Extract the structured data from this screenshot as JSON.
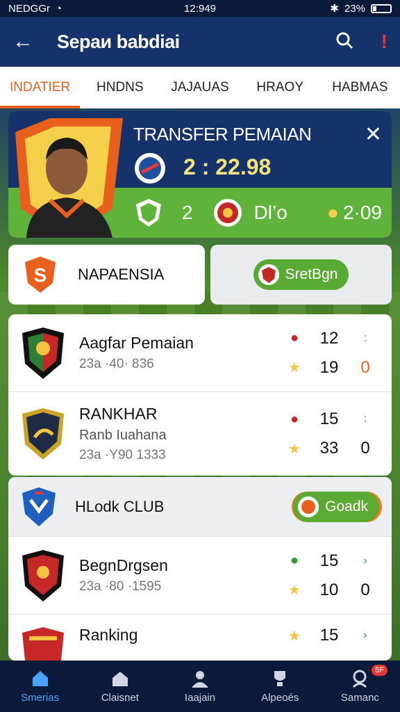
{
  "status": {
    "left_text": "NEDGGr",
    "time": "12:949",
    "battery": "23%"
  },
  "appbar": {
    "title": "Sepaи babdiai"
  },
  "tabs": [
    {
      "label": "INDATIER",
      "active": true
    },
    {
      "label": "HNDNS"
    },
    {
      "label": "JAJAUAS"
    },
    {
      "label": "HRAOY"
    },
    {
      "label": "HABMAS"
    }
  ],
  "transfer": {
    "title": "TRANSFER PEMAIAN",
    "score": "2 : 22.98",
    "left_num": "2",
    "mid_text": "Dl’o",
    "right_val": "2·09"
  },
  "sections": {
    "nap": {
      "label": "NAPAENSIA",
      "pill": "SretBgn"
    },
    "club": {
      "label": "HLodk CLUB",
      "pill": "Goadk"
    }
  },
  "rows": [
    {
      "name": "Aagfar Pemaian",
      "sub": "23a ·40· 836",
      "top_num": "12",
      "bottom_num": "19",
      "bottom_side": "0",
      "top_side": ":"
    },
    {
      "name": "RANKHAR",
      "name2": "Ranb Iuahana",
      "sub": "23a ·Y90 1333",
      "top_num": "15",
      "bottom_num": "33",
      "bottom_side": "0",
      "top_side": ":"
    },
    {
      "name": "BegnDrgsen",
      "sub": "23a ·80 ·1595",
      "top_num": "15",
      "bottom_num": "10",
      "bottom_side": "0",
      "top_side": "›"
    },
    {
      "name": "Ranking",
      "sub": "",
      "top_num": "15",
      "bottom_num": "",
      "bottom_side": "",
      "top_side": "›"
    }
  ],
  "nav": [
    {
      "label": "Smerias",
      "icon": "home-icon",
      "active": true
    },
    {
      "label": "Claisnet",
      "icon": "stadium-icon"
    },
    {
      "label": "Iaajain",
      "icon": "players-icon"
    },
    {
      "label": "Alpeoés",
      "icon": "trophy-icon"
    },
    {
      "label": "Samanc",
      "icon": "profile-icon",
      "badge": "5F"
    }
  ],
  "colors": {
    "accent": "#e8601c",
    "navy": "#15336a",
    "green": "#5fb33a"
  }
}
